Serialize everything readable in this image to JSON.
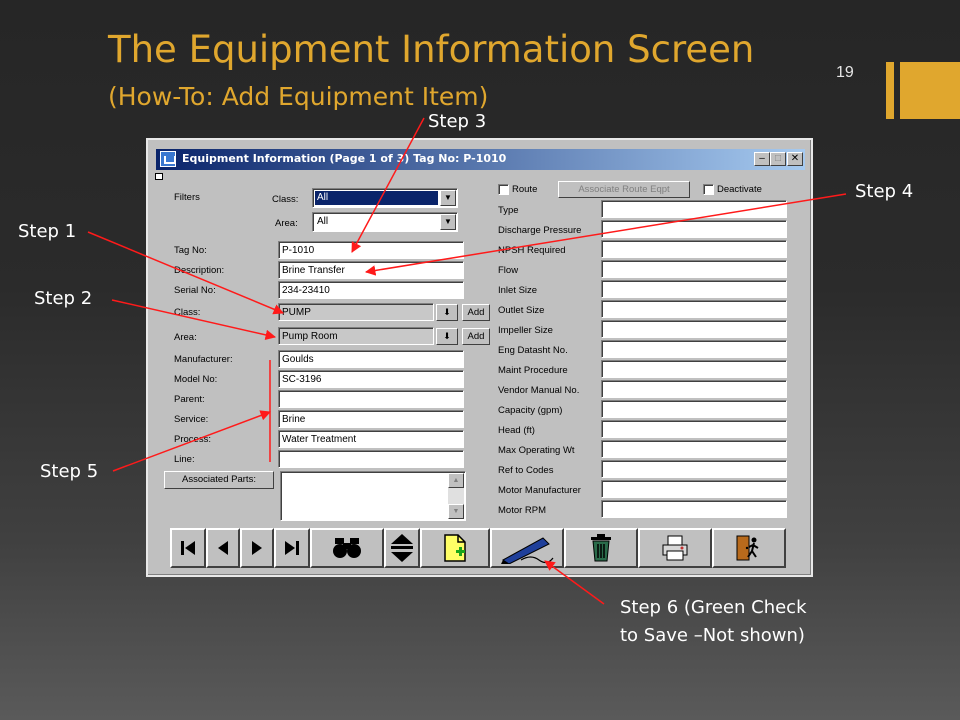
{
  "slide": {
    "title": "The Equipment Information Screen",
    "subtitle": "(How-To:  Add Equipment Item)",
    "page_number": "19",
    "accent_color": "#e0a72e"
  },
  "steps": {
    "step1": "Step 1",
    "step2": "Step 2",
    "step3": "Step 3",
    "step4": "Step 4",
    "step5": "Step 5",
    "step6_line1": "Step 6 (Green Check",
    "step6_line2": "to Save –Not shown)"
  },
  "window": {
    "title": "Equipment Information (Page 1 of 3) Tag No:  P-1010",
    "controls": [
      "minimize-icon",
      "maximize-icon",
      "close-icon"
    ]
  },
  "filters": {
    "label": "Filters",
    "class_label": "Class:",
    "class_value": "All",
    "area_label": "Area:",
    "area_value": "All"
  },
  "form": {
    "tag_no_label": "Tag No:",
    "tag_no": "P-1010",
    "description_label": "Description:",
    "description": "Brine Transfer",
    "serial_no_label": "Serial No:",
    "serial_no": "234-23410",
    "class_label": "Class:",
    "class_value": "PUMP",
    "area_label": "Area:",
    "area_value": "Pump Room",
    "add_label": "Add",
    "manufacturer_label": "Manufacturer:",
    "manufacturer": "Goulds",
    "model_no_label": "Model No:",
    "model_no": "SC-3196",
    "parent_label": "Parent:",
    "parent": "",
    "service_label": "Service:",
    "service": "Brine",
    "process_label": "Process:",
    "process": "Water Treatment",
    "line_label": "Line:",
    "line": "",
    "associated_parts_button": "Associated Parts:"
  },
  "right_panel": {
    "route_label": "Route",
    "associate_route_button": "Associate Route Eqpt",
    "deactivate_label": "Deactivate",
    "fields": [
      "Type",
      "Discharge Pressure",
      "NPSH Required",
      "Flow",
      "Inlet Size",
      "Outlet Size",
      "Impeller Size",
      "Eng Datasht No.",
      "Maint Procedure",
      "Vendor Manual No.",
      "Capacity (gpm)",
      "Head (ft)",
      "Max Operating Wt",
      "Ref to Codes",
      "Motor Manufacturer",
      "Motor RPM"
    ]
  },
  "toolbar": {
    "icons": [
      "first-record-icon",
      "previous-record-icon",
      "next-record-icon",
      "last-record-icon",
      "binoculars-find-icon",
      "sort-up-down-icon",
      "new-document-icon",
      "edit-pen-icon",
      "delete-trash-icon",
      "print-icon",
      "exit-door-icon"
    ]
  }
}
